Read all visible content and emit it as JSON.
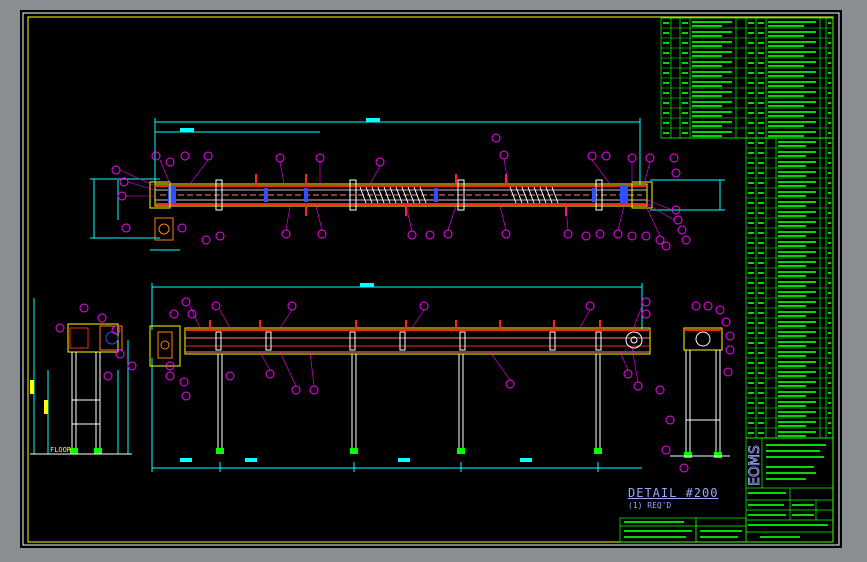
{
  "drawing": {
    "detail_title": "DETAIL #200",
    "detail_subtitle": "(1) REQ'D",
    "floor_label": "FLOOR",
    "title_block_logo": "EOMS",
    "colors": {
      "background": "#000000",
      "border": "#ffff00",
      "frame": "#ffffff",
      "conveyor": "#ff2020",
      "dimension": "#00ffff",
      "balloon": "#ff00ff",
      "table_text": "#00ff00",
      "detail_text": "#9aa6ff",
      "blue_parts": "#3050ff"
    }
  }
}
